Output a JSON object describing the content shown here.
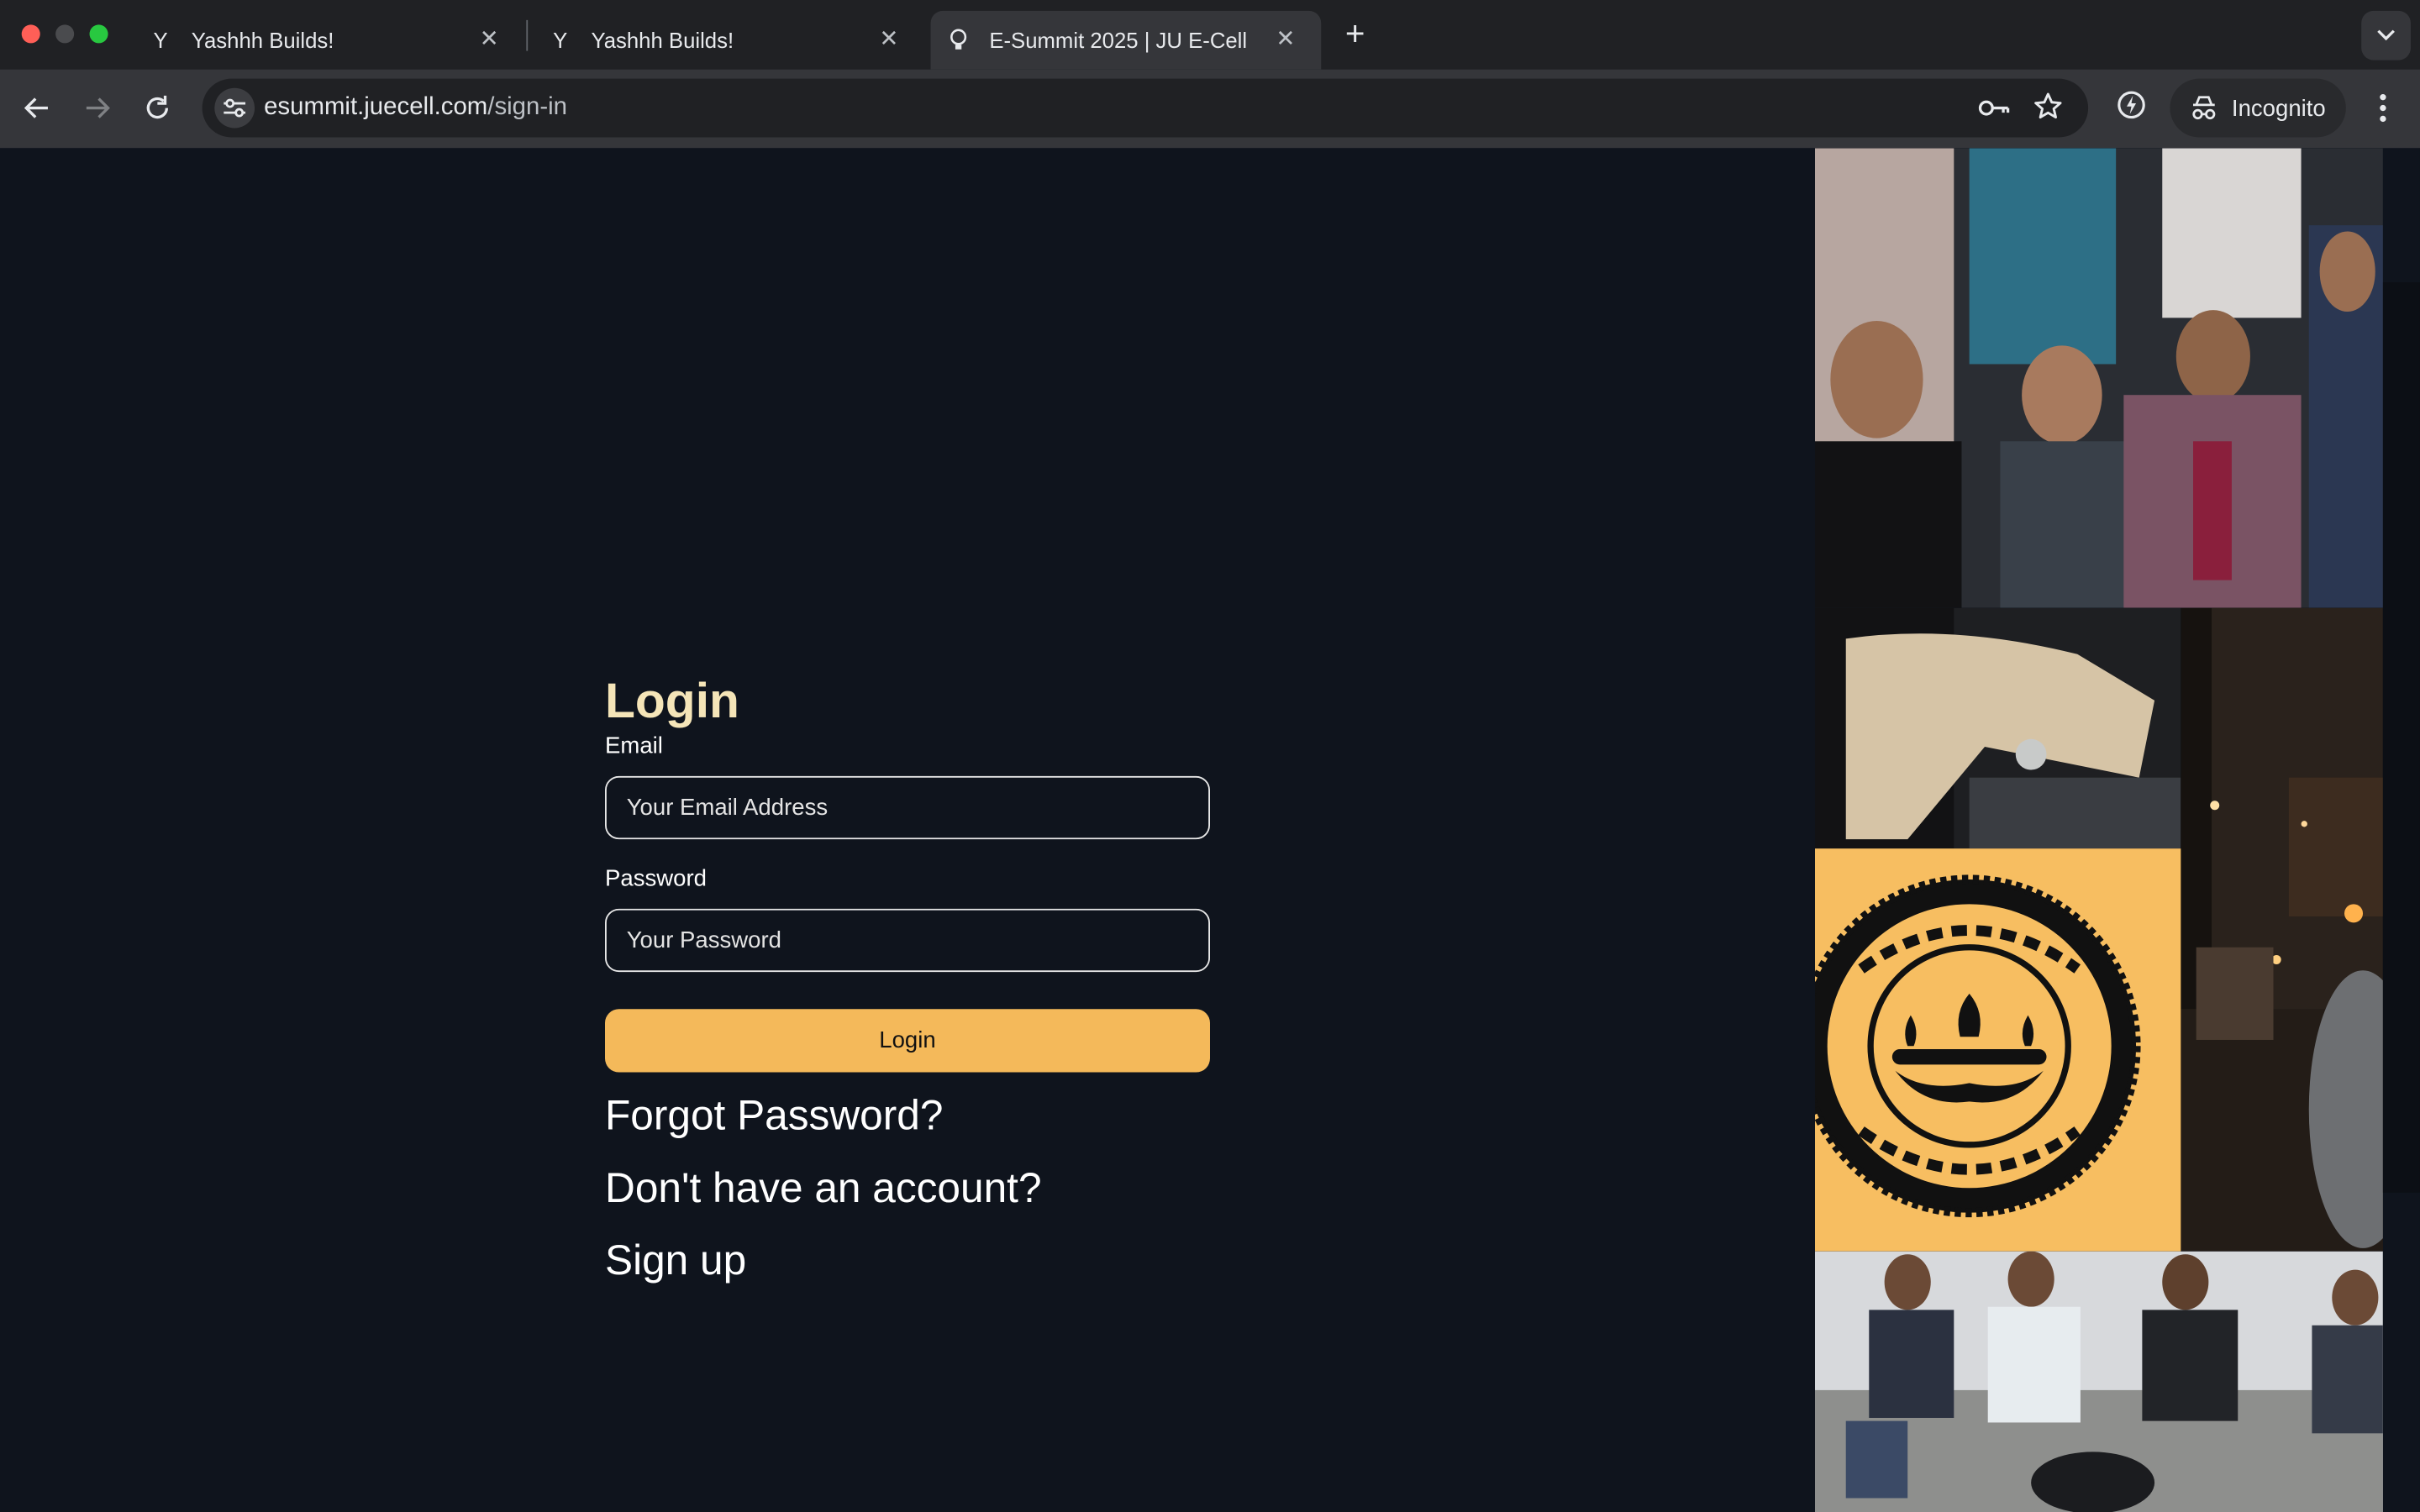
{
  "browser": {
    "tabs": [
      {
        "title": "Yashhh Builds!",
        "favicon": "Y",
        "active": false
      },
      {
        "title": "Yashhh Builds!",
        "favicon": "Y",
        "active": false
      },
      {
        "title": "E-Summit 2025 | JU E-Cell",
        "favicon": "bulb-icon",
        "active": true
      }
    ],
    "url": {
      "host": "esummit.juecell.com",
      "path": "/sign-in"
    },
    "incognito_label": "Incognito"
  },
  "login": {
    "title": "Login",
    "email_label": "Email",
    "email_placeholder": "Your Email Address",
    "password_label": "Password",
    "password_placeholder": "Your Password",
    "submit_label": "Login",
    "forgot_password": "Forgot Password?",
    "no_account": "Don't have an account?",
    "sign_up": "Sign up"
  },
  "colors": {
    "page_bg": "#0f141d",
    "title": "#f5e5b8",
    "button": "#f4b95a",
    "seal_bg": "#f7be61"
  }
}
